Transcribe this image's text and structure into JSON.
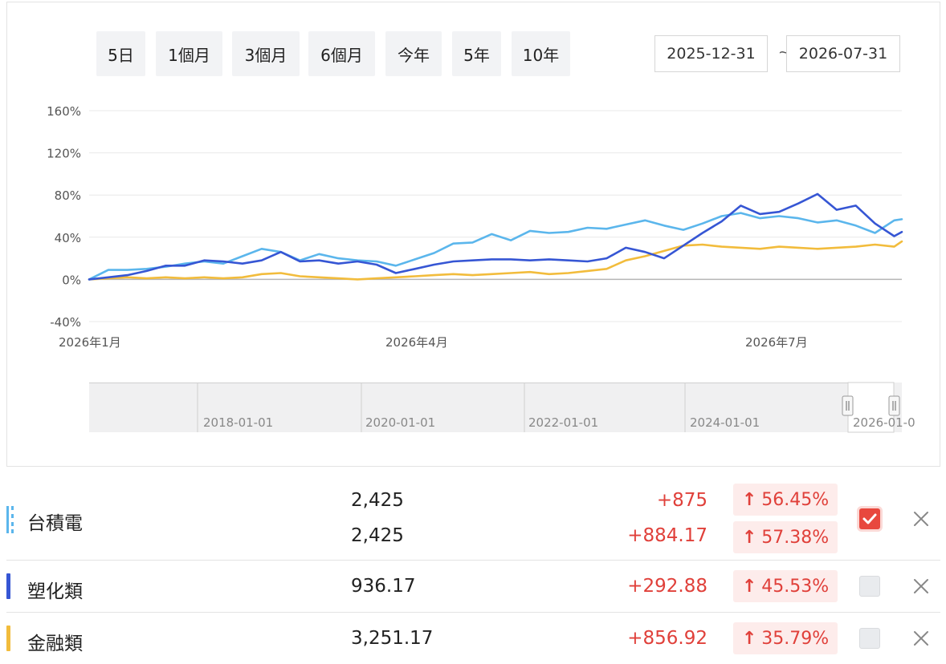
{
  "range_buttons": [
    "5日",
    "1個月",
    "3個月",
    "6個月",
    "今年",
    "5年",
    "10年"
  ],
  "date_range": {
    "start": "2025-12-31",
    "separator": "~",
    "end": "2026-07-31"
  },
  "chart_data": {
    "type": "line",
    "ylim": [
      -40,
      160
    ],
    "yticks": [
      "160%",
      "120%",
      "80%",
      "40%",
      "0%",
      "-40%"
    ],
    "xticks": [
      "2026年1月",
      "2026年4月",
      "2026年7月"
    ],
    "grid": true,
    "x": [
      0,
      5,
      10,
      15,
      20,
      25,
      30,
      35,
      40,
      45,
      50,
      55,
      60,
      65,
      70,
      75,
      80,
      85,
      90,
      95,
      100,
      105,
      110,
      115,
      120,
      125,
      130,
      135,
      140,
      145,
      150,
      155,
      160,
      165,
      170,
      175,
      180,
      185,
      190,
      195,
      200,
      205,
      210,
      212
    ],
    "series": [
      {
        "name": "台積電",
        "color": "#5bb6ec",
        "values": [
          0,
          9,
          9,
          10,
          12,
          15,
          17,
          15,
          22,
          29,
          26,
          18,
          24,
          20,
          18,
          17,
          13,
          19,
          25,
          34,
          35,
          43,
          37,
          46,
          44,
          45,
          49,
          48,
          52,
          56,
          51,
          47,
          53,
          60,
          63,
          58,
          60,
          58,
          54,
          56,
          51,
          44,
          56,
          57
        ]
      },
      {
        "name": "塑化類",
        "color": "#3656d4",
        "values": [
          0,
          2,
          4,
          8,
          13,
          13,
          18,
          17,
          15,
          18,
          26,
          17,
          18,
          15,
          17,
          14,
          6,
          10,
          14,
          17,
          18,
          19,
          19,
          18,
          19,
          18,
          17,
          20,
          30,
          26,
          20,
          32,
          44,
          55,
          70,
          62,
          64,
          72,
          81,
          66,
          70,
          53,
          41,
          45
        ]
      },
      {
        "name": "金融類",
        "color": "#f2bc3c",
        "values": [
          0,
          1,
          2,
          1,
          2,
          1,
          2,
          1,
          2,
          5,
          6,
          3,
          2,
          1,
          0,
          1,
          2,
          3,
          4,
          5,
          4,
          5,
          6,
          7,
          5,
          6,
          8,
          10,
          18,
          22,
          27,
          32,
          33,
          31,
          30,
          29,
          31,
          30,
          29,
          30,
          31,
          33,
          31,
          36
        ]
      }
    ]
  },
  "navigator": {
    "labels": [
      "2018-01-01",
      "2020-01-01",
      "2022-01-01",
      "2024-01-01",
      "2026-01-0"
    ]
  },
  "rows": [
    {
      "name": "台積電",
      "color": "#5bb6ec",
      "dashed": true,
      "lines": [
        {
          "price": "2,425",
          "change": "+875",
          "pct": "56.45%"
        },
        {
          "price": "2,425",
          "change": "+884.17",
          "pct": "57.38%"
        }
      ],
      "checked": true
    },
    {
      "name": "塑化類",
      "color": "#3656d4",
      "dashed": false,
      "lines": [
        {
          "price": "936.17",
          "change": "+292.88",
          "pct": "45.53%"
        }
      ],
      "checked": false
    },
    {
      "name": "金融類",
      "color": "#f2bc3c",
      "dashed": false,
      "lines": [
        {
          "price": "3,251.17",
          "change": "+856.92",
          "pct": "35.79%"
        }
      ],
      "checked": false
    }
  ],
  "icons": {
    "arrow": "↑",
    "close": "close-icon",
    "check": "check-icon"
  }
}
